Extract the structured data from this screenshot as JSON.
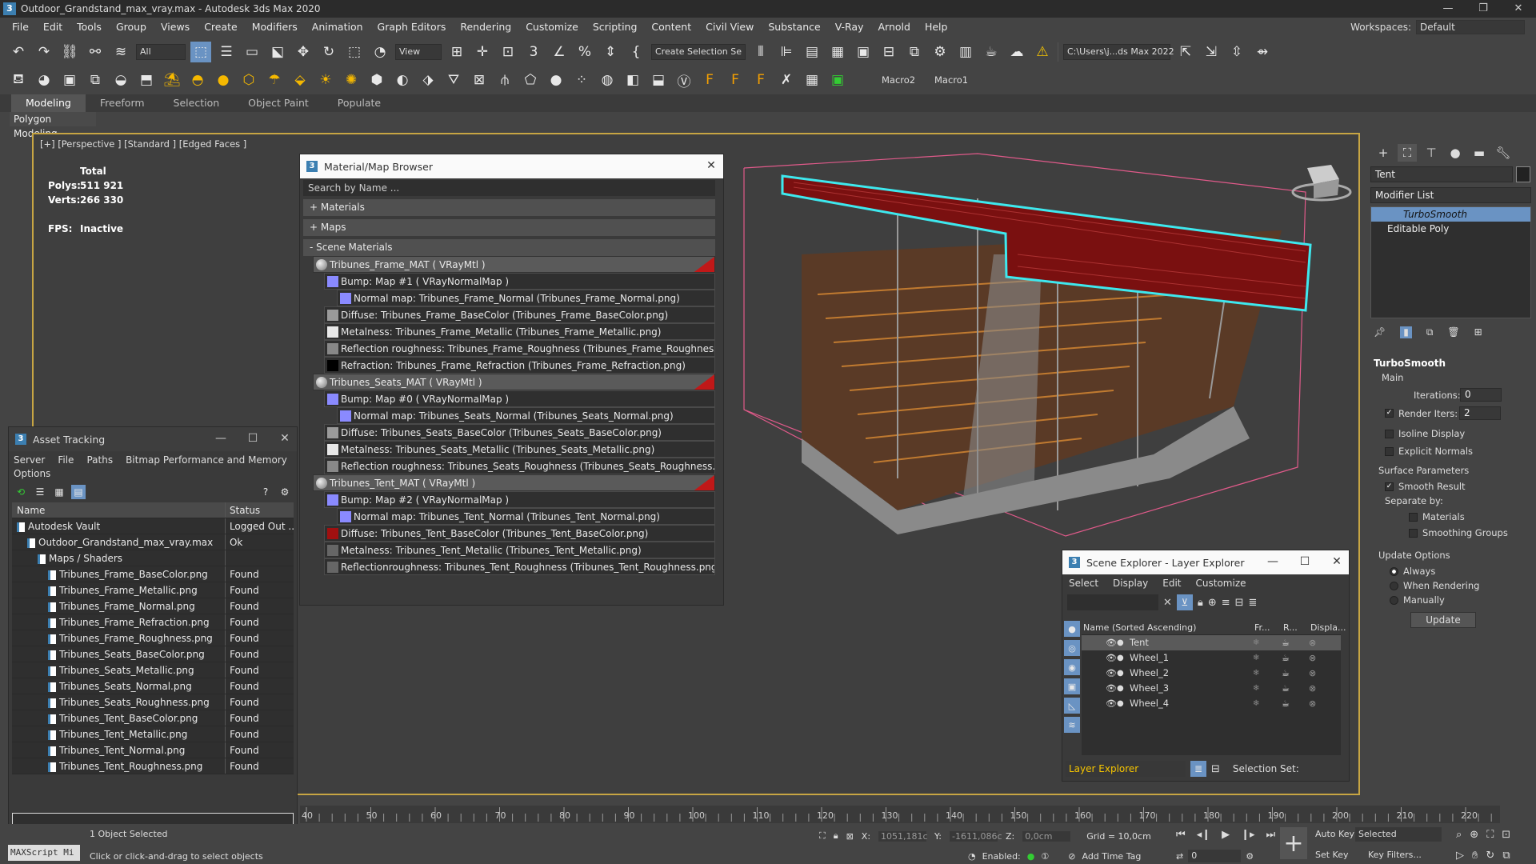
{
  "title_bar": {
    "text": "Outdoor_Grandstand_max_vray.max - Autodesk 3ds Max 2020",
    "app_icon": "3",
    "minimize": "—",
    "restore": "❐",
    "close": "✕"
  },
  "menu": [
    "File",
    "Edit",
    "Tools",
    "Group",
    "Views",
    "Create",
    "Modifiers",
    "Animation",
    "Graph Editors",
    "Rendering",
    "Customize",
    "Scripting",
    "Content",
    "Civil View",
    "Substance",
    "V-Ray",
    "Arnold",
    "Help"
  ],
  "workspaces": {
    "label": "Workspaces:",
    "value": "Default"
  },
  "toolbar1": {
    "filter": "All",
    "view": "View",
    "selection_set": "Create Selection Se",
    "path": "C:\\Users\\j...ds Max 2022"
  },
  "toolbar2": {
    "macro2": "Macro2",
    "macro1": "Macro1"
  },
  "ribbon": {
    "tabs": [
      "Modeling",
      "Freeform",
      "Selection",
      "Object Paint",
      "Populate"
    ],
    "sub": "Polygon Modeling"
  },
  "viewport": {
    "label": "[+] [Perspective ] [Standard ] [Edged Faces ]",
    "total_label": "Total",
    "polys_label": "Polys:",
    "polys": "511 921",
    "verts_label": "Verts:",
    "verts": "266 330",
    "fps_label": "FPS:",
    "fps": "Inactive"
  },
  "material_browser": {
    "title": "Material/Map Browser",
    "search_placeholder": "Search by Name ...",
    "sections": [
      "+ Materials",
      "+ Maps",
      "- Scene Materials"
    ],
    "materials": [
      {
        "name": "Tribunes_Frame_MAT  ( VRayMtl )",
        "children": [
          {
            "label": "Bump: Map #1  ( VRayNormalMap )",
            "level": 1,
            "swatch": "#8a8aff"
          },
          {
            "label": "Normal map: Tribunes_Frame_Normal (Tribunes_Frame_Normal.png)",
            "level": 2,
            "swatch": "#8a8aff"
          },
          {
            "label": "Diffuse: Tribunes_Frame_BaseColor (Tribunes_Frame_BaseColor.png)",
            "level": 1,
            "swatch": "#9a9a9a"
          },
          {
            "label": "Metalness: Tribunes_Frame_Metallic (Tribunes_Frame_Metallic.png)",
            "level": 1,
            "swatch": "#e8e8e8"
          },
          {
            "label": "Reflection roughness: Tribunes_Frame_Roughness (Tribunes_Frame_Roughness.png)",
            "level": 1,
            "swatch": "#888"
          },
          {
            "label": "Refraction: Tribunes_Frame_Refraction (Tribunes_Frame_Refraction.png)",
            "level": 1,
            "swatch": "#000"
          }
        ]
      },
      {
        "name": "Tribunes_Seats_MAT  ( VRayMtl )",
        "children": [
          {
            "label": "Bump: Map #0  ( VRayNormalMap )",
            "level": 1,
            "swatch": "#8a8aff"
          },
          {
            "label": "Normal map: Tribunes_Seats_Normal (Tribunes_Seats_Normal.png)",
            "level": 2,
            "swatch": "#8a8aff"
          },
          {
            "label": "Diffuse: Tribunes_Seats_BaseColor (Tribunes_Seats_BaseColor.png)",
            "level": 1,
            "swatch": "#9a9a9a"
          },
          {
            "label": "Metalness: Tribunes_Seats_Metallic (Tribunes_Seats_Metallic.png)",
            "level": 1,
            "swatch": "#e8e8e8"
          },
          {
            "label": "Reflection roughness: Tribunes_Seats_Roughness (Tribunes_Seats_Roughness.png)",
            "level": 1,
            "swatch": "#888"
          }
        ]
      },
      {
        "name": "Tribunes_Tent_MAT  ( VRayMtl )",
        "children": [
          {
            "label": "Bump: Map #2  ( VRayNormalMap )",
            "level": 1,
            "swatch": "#8a8aff"
          },
          {
            "label": "Normal map: Tribunes_Tent_Normal (Tribunes_Tent_Normal.png)",
            "level": 2,
            "swatch": "#8a8aff"
          },
          {
            "label": "Diffuse: Tribunes_Tent_BaseColor (Tribunes_Tent_BaseColor.png)",
            "level": 1,
            "swatch": "#a01010"
          },
          {
            "label": "Metalness: Tribunes_Tent_Metallic (Tribunes_Tent_Metallic.png)",
            "level": 1,
            "swatch": "#666"
          },
          {
            "label": "Reflectionroughness: Tribunes_Tent_Roughness (Tribunes_Tent_Roughness.png)",
            "level": 1,
            "swatch": "#666"
          }
        ]
      }
    ]
  },
  "asset_tracking": {
    "title": "Asset Tracking",
    "menu": [
      "Server",
      "File",
      "Paths",
      "Bitmap Performance and Memory"
    ],
    "menu2": "Options",
    "columns": [
      "Name",
      "Status"
    ],
    "rows": [
      {
        "name": "Autodesk Vault",
        "status": "Logged Out ...",
        "indent": 0
      },
      {
        "name": "Outdoor_Grandstand_max_vray.max",
        "status": "Ok",
        "indent": 1
      },
      {
        "name": "Maps / Shaders",
        "status": "",
        "indent": 2
      },
      {
        "name": "Tribunes_Frame_BaseColor.png",
        "status": "Found",
        "indent": 3
      },
      {
        "name": "Tribunes_Frame_Metallic.png",
        "status": "Found",
        "indent": 3
      },
      {
        "name": "Tribunes_Frame_Normal.png",
        "status": "Found",
        "indent": 3
      },
      {
        "name": "Tribunes_Frame_Refraction.png",
        "status": "Found",
        "indent": 3
      },
      {
        "name": "Tribunes_Frame_Roughness.png",
        "status": "Found",
        "indent": 3
      },
      {
        "name": "Tribunes_Seats_BaseColor.png",
        "status": "Found",
        "indent": 3
      },
      {
        "name": "Tribunes_Seats_Metallic.png",
        "status": "Found",
        "indent": 3
      },
      {
        "name": "Tribunes_Seats_Normal.png",
        "status": "Found",
        "indent": 3
      },
      {
        "name": "Tribunes_Seats_Roughness.png",
        "status": "Found",
        "indent": 3
      },
      {
        "name": "Tribunes_Tent_BaseColor.png",
        "status": "Found",
        "indent": 3
      },
      {
        "name": "Tribunes_Tent_Metallic.png",
        "status": "Found",
        "indent": 3
      },
      {
        "name": "Tribunes_Tent_Normal.png",
        "status": "Found",
        "indent": 3
      },
      {
        "name": "Tribunes_Tent_Roughness.png",
        "status": "Found",
        "indent": 3
      }
    ]
  },
  "scene_explorer": {
    "title": "Scene Explorer - Layer Explorer",
    "menu": [
      "Select",
      "Display",
      "Edit",
      "Customize"
    ],
    "columns": [
      "Name (Sorted Ascending)",
      "Fr...",
      "R...",
      "Displa..."
    ],
    "rows": [
      "Tent",
      "Wheel_1",
      "Wheel_2",
      "Wheel_3",
      "Wheel_4"
    ],
    "footer_layer": "Layer Explorer",
    "footer_set": "Selection Set:"
  },
  "command_panel": {
    "object_name": "Tent",
    "modifier_list": "Modifier List",
    "stack": [
      "TurboSmooth",
      "Editable Poly"
    ],
    "rollout": "TurboSmooth",
    "main": "Main",
    "iterations_label": "Iterations:",
    "iterations": "0",
    "render_iters_label": "Render Iters:",
    "render_iters": "2",
    "isoline": "Isoline Display",
    "explicit": "Explicit Normals",
    "surface": "Surface Parameters",
    "smooth": "Smooth Result",
    "separate": "Separate by:",
    "materials": "Materials",
    "smoothing_groups": "Smoothing Groups",
    "update_options": "Update Options",
    "always": "Always",
    "when_rendering": "When Rendering",
    "manually": "Manually",
    "update": "Update"
  },
  "timeline": {
    "ticks": [
      "40",
      "50",
      "60",
      "70",
      "80",
      "90",
      "100",
      "110",
      "120",
      "130",
      "140",
      "150",
      "160",
      "170",
      "180",
      "190",
      "200",
      "210",
      "220"
    ]
  },
  "status": {
    "maxscript": "MAXScript Mi",
    "selected": "1 Object Selected",
    "prompt": "Click or click-and-drag to select objects",
    "x_label": "X:",
    "x": "1051,181c",
    "y_label": "Y:",
    "y": "-1611,086c",
    "z_label": "Z:",
    "z": "0,0cm",
    "grid": "Grid = 10,0cm",
    "enabled": "Enabled:",
    "add_time_tag": "Add Time Tag",
    "frame": "0",
    "auto_key": "Auto Key",
    "set_key": "Set Key",
    "selected_drop": "Selected",
    "key_filters": "Key Filters..."
  }
}
